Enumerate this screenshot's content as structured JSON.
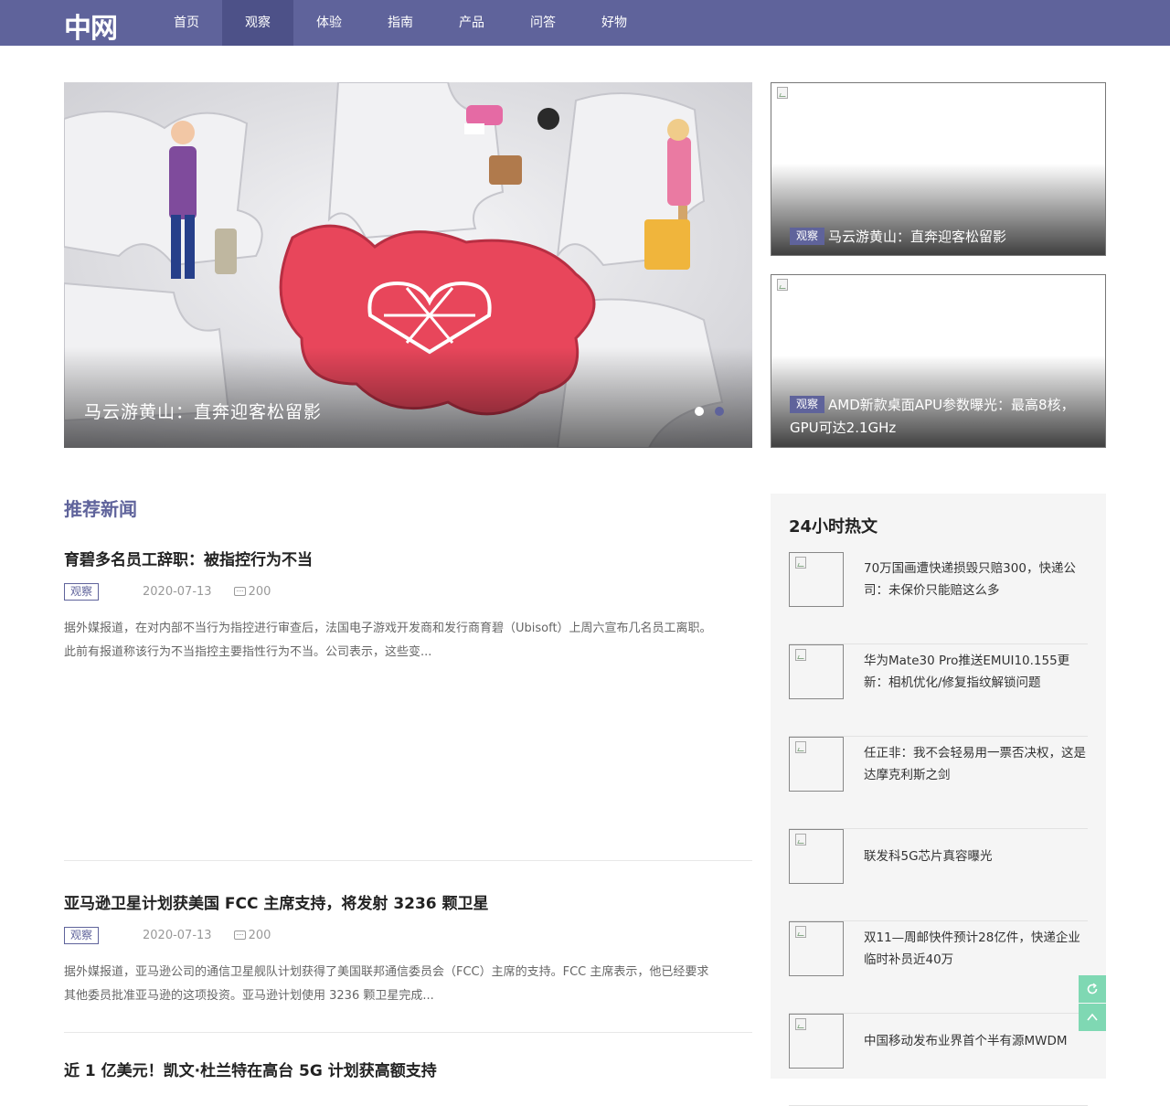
{
  "header": {
    "logo": "中网",
    "nav": [
      "首页",
      "观察",
      "体验",
      "指南",
      "产品",
      "问答",
      "好物"
    ],
    "active_index": 1
  },
  "hero": {
    "caption": "马云游黄山：直奔迎客松留影",
    "slide_count": 2,
    "active_slide": 2
  },
  "side_cards": [
    {
      "tag": "观察",
      "title": "马云游黄山：直奔迎客松留影"
    },
    {
      "tag": "观察",
      "title": "AMD新款桌面APU参数曝光：最高8核，GPU可达2.1GHz"
    }
  ],
  "recommended": {
    "title": "推荐新闻",
    "articles": [
      {
        "title": "育碧多名员工辞职：被指控行为不当",
        "tag": "观察",
        "date": "2020-07-13",
        "comments": "200",
        "excerpt": "据外媒报道，在对内部不当行为指控进行审查后，法国电子游戏开发商和发行商育碧（Ubisoft）上周六宣布几名员工离职。此前有报道称该行为不当指控主要指性行为不当。公司表示，这些变..."
      },
      {
        "title": "亚马逊卫星计划获美国 FCC 主席支持，将发射 3236 颗卫星",
        "tag": "观察",
        "date": "2020-07-13",
        "comments": "200",
        "excerpt": "据外媒报道，亚马逊公司的通信卫星舰队计划获得了美国联邦通信委员会（FCC）主席的支持。FCC 主席表示，他已经要求其他委员批准亚马逊的这项投资。亚马逊计划使用 3236 颗卫星完成..."
      },
      {
        "title": "近 1 亿美元！凯文·杜兰特在高台 5G 计划获高额支持"
      }
    ]
  },
  "hot": {
    "title": "24小时热文",
    "items": [
      "70万国画遭快递损毁只赔300，快递公司：未保价只能赔这么多",
      "华为Mate30 Pro推送EMUI10.155更新：相机优化/修复指纹解锁问题",
      "任正非：我不会轻易用一票否决权，这是达摩克利斯之剑",
      "联发科5G芯片真容曝光",
      "双11—周邮快件预计28亿件，快递企业临时补员近40万",
      "中国移动发布业界首个半有源MWDM"
    ]
  },
  "floating": {
    "refresh_icon": "refresh-icon",
    "top_icon": "chevron-up-icon"
  }
}
